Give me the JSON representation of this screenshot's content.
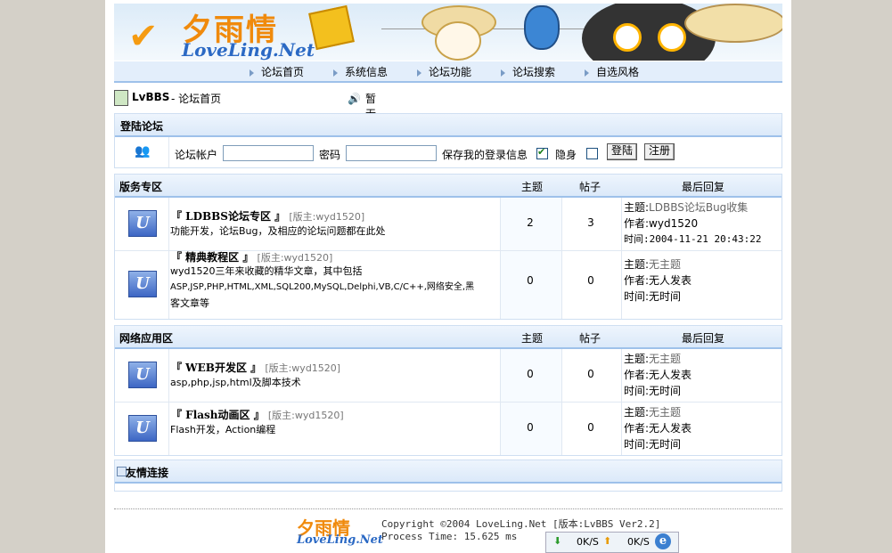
{
  "brand": {
    "name_cn": "夕雨情",
    "name_en": "LoveLing.Net"
  },
  "nav": {
    "items": [
      "论坛首页",
      "系统信息",
      "论坛功能",
      "论坛搜索",
      "自选风格"
    ]
  },
  "breadcrumb": {
    "site": "LvBBS",
    "page": "- 论坛首页",
    "notice": "暂无公告"
  },
  "login": {
    "title": "登陆论坛",
    "account_label": "论坛帐户",
    "account_value": "",
    "password_label": "密码",
    "password_value": "",
    "remember_label": "保存我的登录信息",
    "hidden_label": "隐身",
    "login_button": "登陆",
    "register_button": "注册"
  },
  "columns": {
    "topics": "主题",
    "posts": "帖子",
    "last": "最后回复"
  },
  "sections": [
    {
      "title": "版务专区",
      "forums": [
        {
          "name": "『 LDBBS论坛专区 』",
          "mod": "[版主:wyd1520]",
          "desc": [
            "功能开发，论坛Bug，及相应的论坛问题都在此处"
          ],
          "topics": "2",
          "posts": "3",
          "last_topic_label": "主题:",
          "last_topic": "LDBBS论坛Bug收集",
          "author": "作者:wyd1520",
          "time": "时间:2004-11-21 20:43:22"
        },
        {
          "name": "『 精典教程区 』",
          "mod": "[版主:wyd1520]",
          "desc": [
            "wyd1520三年来收藏的精华文章，其中包括",
            "ASP,JSP,PHP,HTML,XML,SQL200,MySQL,Delphi,VB,C/C++,网络安全,黑",
            "客文章等"
          ],
          "topics": "0",
          "posts": "0",
          "last_topic_label": "主题:",
          "last_topic": "无主题",
          "author": "作者:无人发表",
          "time": "时间:无时间"
        }
      ]
    },
    {
      "title": "网络应用区",
      "forums": [
        {
          "name": "『 WEB开发区 』",
          "mod": "[版主:wyd1520]",
          "desc": [
            "asp,php,jsp,html及脚本技术"
          ],
          "topics": "0",
          "posts": "0",
          "last_topic_label": "主题:",
          "last_topic": "无主题",
          "author": "作者:无人发表",
          "time": "时间:无时间"
        },
        {
          "name": "『 Flash动画区 』",
          "mod": "[版主:wyd1520]",
          "desc": [
            "Flash开发，Action编程"
          ],
          "topics": "0",
          "posts": "0",
          "last_topic_label": "主题:",
          "last_topic": "无主题",
          "author": "作者:无人发表",
          "time": "时间:无时间"
        }
      ]
    }
  ],
  "links": {
    "title": "友情连接"
  },
  "footer": {
    "copyright": "Copyright ©2004 LoveLing.Net [版本:LvBBS Ver2.2]",
    "process": "Process Time: 15.625 ms"
  },
  "statusbar": {
    "down": "0K/S",
    "up": "0K/S"
  }
}
